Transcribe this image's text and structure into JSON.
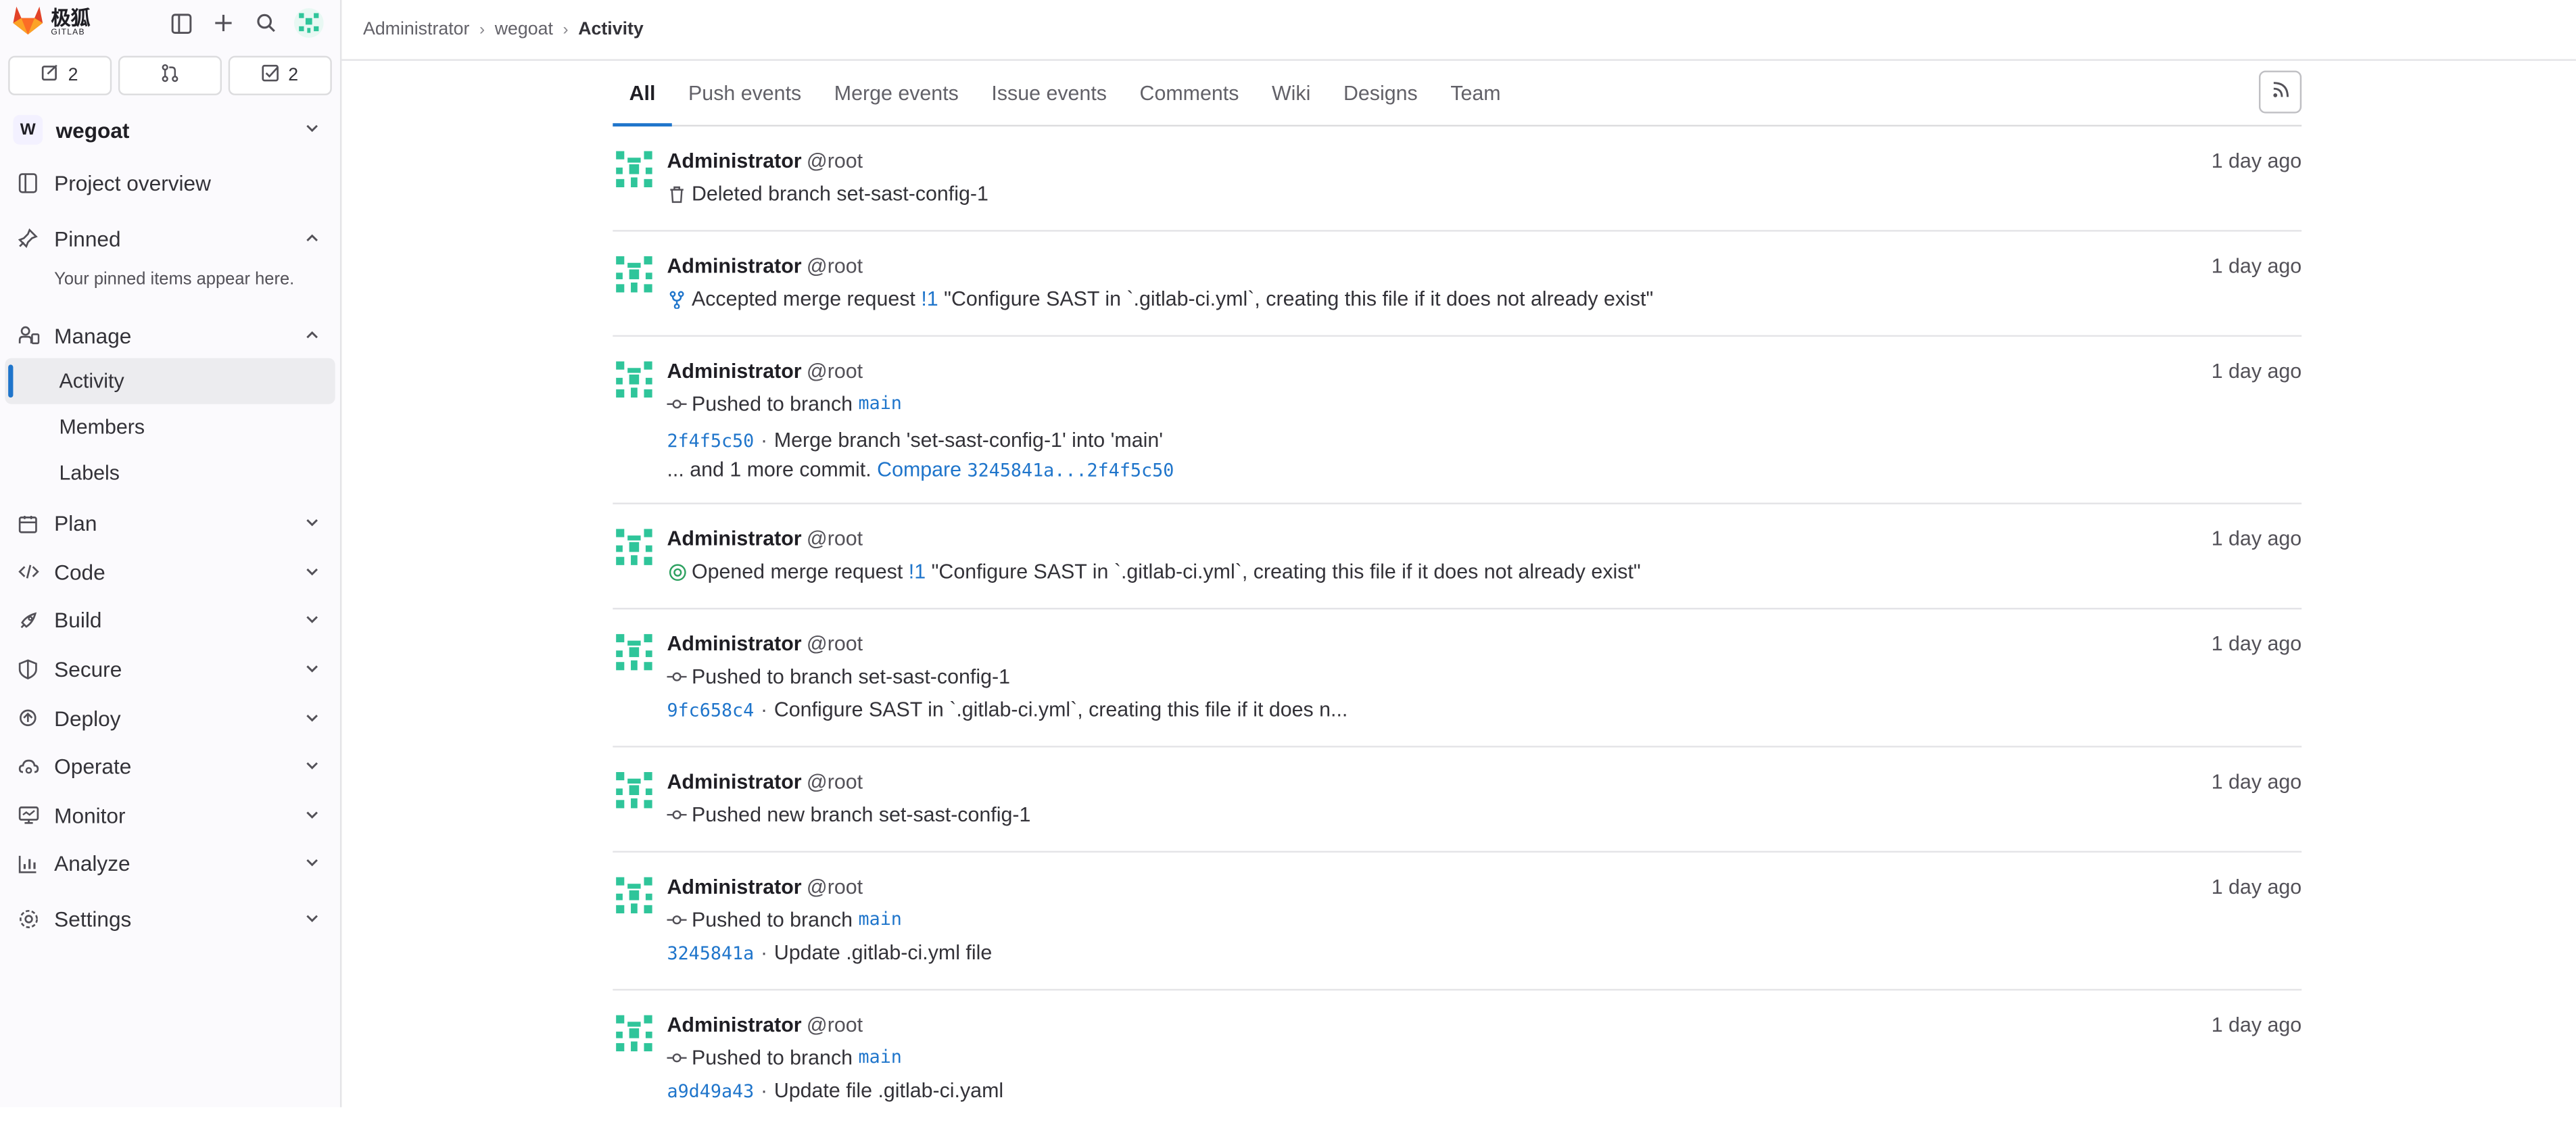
{
  "brand": {
    "cn": "极狐",
    "en": "GITLAB"
  },
  "counters": {
    "issues": "2",
    "todos": "2"
  },
  "project": {
    "avatar_letter": "W",
    "name": "wegoat"
  },
  "sidebar": {
    "overview": "Project overview",
    "pinned": "Pinned",
    "pinned_hint": "Your pinned items appear here.",
    "manage": "Manage",
    "manage_items": [
      "Activity",
      "Members",
      "Labels"
    ],
    "sections": [
      "Plan",
      "Code",
      "Build",
      "Secure",
      "Deploy",
      "Operate",
      "Monitor",
      "Analyze"
    ],
    "settings": "Settings"
  },
  "breadcrumb": [
    "Administrator",
    "wegoat",
    "Activity"
  ],
  "tabs": [
    "All",
    "Push events",
    "Merge events",
    "Issue events",
    "Comments",
    "Wiki",
    "Designs",
    "Team"
  ],
  "events": [
    {
      "name": "Administrator",
      "user": "@root",
      "time": "1 day ago",
      "line": "Deleted branch set-sast-config-1"
    },
    {
      "name": "Administrator",
      "user": "@root",
      "time": "1 day ago",
      "action": "Accepted merge request",
      "ref": "!1",
      "title": "\"Configure SAST in `.gitlab-ci.yml`, creating this file if it does not already exist\""
    },
    {
      "name": "Administrator",
      "user": "@root",
      "time": "1 day ago",
      "action": "Pushed to branch",
      "branch": "main",
      "sha": "2f4f5c50",
      "message": "Merge branch 'set-sast-config-1' into 'main'",
      "more": "... and 1 more commit.",
      "compare_label": "Compare",
      "compare_range": "3245841a...2f4f5c50"
    },
    {
      "name": "Administrator",
      "user": "@root",
      "time": "1 day ago",
      "action": "Opened merge request",
      "ref": "!1",
      "title": "\"Configure SAST in `.gitlab-ci.yml`, creating this file if it does not already exist\""
    },
    {
      "name": "Administrator",
      "user": "@root",
      "time": "1 day ago",
      "line": "Pushed to branch set-sast-config-1",
      "sha": "9fc658c4",
      "message": "Configure SAST in `.gitlab-ci.yml`, creating this file if it does n..."
    },
    {
      "name": "Administrator",
      "user": "@root",
      "time": "1 day ago",
      "line": "Pushed new branch set-sast-config-1"
    },
    {
      "name": "Administrator",
      "user": "@root",
      "time": "1 day ago",
      "action": "Pushed to branch",
      "branch": "main",
      "sha": "3245841a",
      "message": "Update .gitlab-ci.yml file"
    },
    {
      "name": "Administrator",
      "user": "@root",
      "time": "1 day ago",
      "action": "Pushed to branch",
      "branch": "main",
      "sha": "a9d49a43",
      "message": "Update file .gitlab-ci.yaml"
    }
  ],
  "colors": {
    "accent": "#1f75cb",
    "avatar": "#2fc59a",
    "logo": "#e24329"
  }
}
